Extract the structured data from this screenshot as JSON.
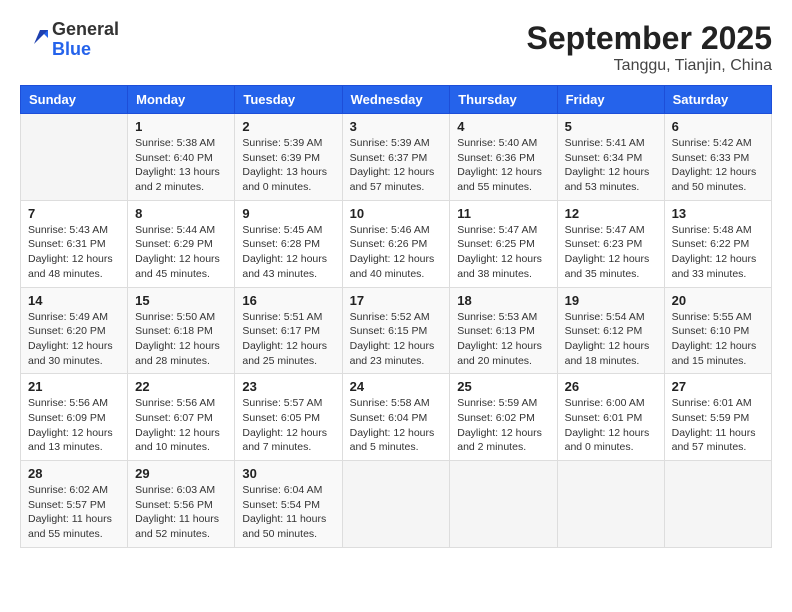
{
  "header": {
    "logo_general": "General",
    "logo_blue": "Blue",
    "month_title": "September 2025",
    "location": "Tanggu, Tianjin, China"
  },
  "weekdays": [
    "Sunday",
    "Monday",
    "Tuesday",
    "Wednesday",
    "Thursday",
    "Friday",
    "Saturday"
  ],
  "weeks": [
    [
      {
        "day": "",
        "info": ""
      },
      {
        "day": "1",
        "info": "Sunrise: 5:38 AM\nSunset: 6:40 PM\nDaylight: 13 hours\nand 2 minutes."
      },
      {
        "day": "2",
        "info": "Sunrise: 5:39 AM\nSunset: 6:39 PM\nDaylight: 13 hours\nand 0 minutes."
      },
      {
        "day": "3",
        "info": "Sunrise: 5:39 AM\nSunset: 6:37 PM\nDaylight: 12 hours\nand 57 minutes."
      },
      {
        "day": "4",
        "info": "Sunrise: 5:40 AM\nSunset: 6:36 PM\nDaylight: 12 hours\nand 55 minutes."
      },
      {
        "day": "5",
        "info": "Sunrise: 5:41 AM\nSunset: 6:34 PM\nDaylight: 12 hours\nand 53 minutes."
      },
      {
        "day": "6",
        "info": "Sunrise: 5:42 AM\nSunset: 6:33 PM\nDaylight: 12 hours\nand 50 minutes."
      }
    ],
    [
      {
        "day": "7",
        "info": "Sunrise: 5:43 AM\nSunset: 6:31 PM\nDaylight: 12 hours\nand 48 minutes."
      },
      {
        "day": "8",
        "info": "Sunrise: 5:44 AM\nSunset: 6:29 PM\nDaylight: 12 hours\nand 45 minutes."
      },
      {
        "day": "9",
        "info": "Sunrise: 5:45 AM\nSunset: 6:28 PM\nDaylight: 12 hours\nand 43 minutes."
      },
      {
        "day": "10",
        "info": "Sunrise: 5:46 AM\nSunset: 6:26 PM\nDaylight: 12 hours\nand 40 minutes."
      },
      {
        "day": "11",
        "info": "Sunrise: 5:47 AM\nSunset: 6:25 PM\nDaylight: 12 hours\nand 38 minutes."
      },
      {
        "day": "12",
        "info": "Sunrise: 5:47 AM\nSunset: 6:23 PM\nDaylight: 12 hours\nand 35 minutes."
      },
      {
        "day": "13",
        "info": "Sunrise: 5:48 AM\nSunset: 6:22 PM\nDaylight: 12 hours\nand 33 minutes."
      }
    ],
    [
      {
        "day": "14",
        "info": "Sunrise: 5:49 AM\nSunset: 6:20 PM\nDaylight: 12 hours\nand 30 minutes."
      },
      {
        "day": "15",
        "info": "Sunrise: 5:50 AM\nSunset: 6:18 PM\nDaylight: 12 hours\nand 28 minutes."
      },
      {
        "day": "16",
        "info": "Sunrise: 5:51 AM\nSunset: 6:17 PM\nDaylight: 12 hours\nand 25 minutes."
      },
      {
        "day": "17",
        "info": "Sunrise: 5:52 AM\nSunset: 6:15 PM\nDaylight: 12 hours\nand 23 minutes."
      },
      {
        "day": "18",
        "info": "Sunrise: 5:53 AM\nSunset: 6:13 PM\nDaylight: 12 hours\nand 20 minutes."
      },
      {
        "day": "19",
        "info": "Sunrise: 5:54 AM\nSunset: 6:12 PM\nDaylight: 12 hours\nand 18 minutes."
      },
      {
        "day": "20",
        "info": "Sunrise: 5:55 AM\nSunset: 6:10 PM\nDaylight: 12 hours\nand 15 minutes."
      }
    ],
    [
      {
        "day": "21",
        "info": "Sunrise: 5:56 AM\nSunset: 6:09 PM\nDaylight: 12 hours\nand 13 minutes."
      },
      {
        "day": "22",
        "info": "Sunrise: 5:56 AM\nSunset: 6:07 PM\nDaylight: 12 hours\nand 10 minutes."
      },
      {
        "day": "23",
        "info": "Sunrise: 5:57 AM\nSunset: 6:05 PM\nDaylight: 12 hours\nand 7 minutes."
      },
      {
        "day": "24",
        "info": "Sunrise: 5:58 AM\nSunset: 6:04 PM\nDaylight: 12 hours\nand 5 minutes."
      },
      {
        "day": "25",
        "info": "Sunrise: 5:59 AM\nSunset: 6:02 PM\nDaylight: 12 hours\nand 2 minutes."
      },
      {
        "day": "26",
        "info": "Sunrise: 6:00 AM\nSunset: 6:01 PM\nDaylight: 12 hours\nand 0 minutes."
      },
      {
        "day": "27",
        "info": "Sunrise: 6:01 AM\nSunset: 5:59 PM\nDaylight: 11 hours\nand 57 minutes."
      }
    ],
    [
      {
        "day": "28",
        "info": "Sunrise: 6:02 AM\nSunset: 5:57 PM\nDaylight: 11 hours\nand 55 minutes."
      },
      {
        "day": "29",
        "info": "Sunrise: 6:03 AM\nSunset: 5:56 PM\nDaylight: 11 hours\nand 52 minutes."
      },
      {
        "day": "30",
        "info": "Sunrise: 6:04 AM\nSunset: 5:54 PM\nDaylight: 11 hours\nand 50 minutes."
      },
      {
        "day": "",
        "info": ""
      },
      {
        "day": "",
        "info": ""
      },
      {
        "day": "",
        "info": ""
      },
      {
        "day": "",
        "info": ""
      }
    ]
  ]
}
